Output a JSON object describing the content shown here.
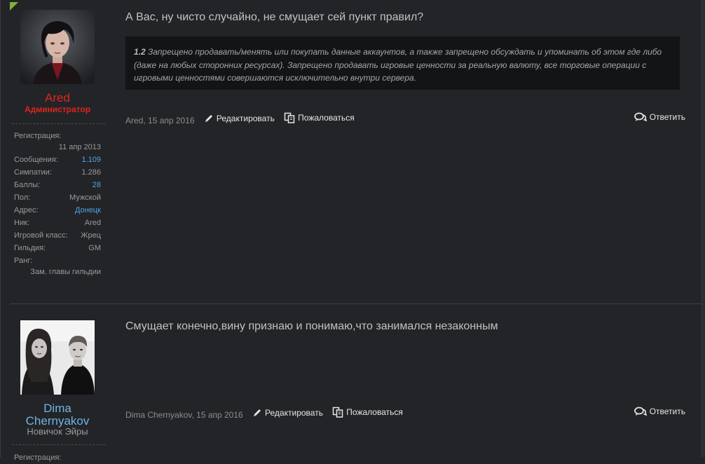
{
  "posts": [
    {
      "author": "Ared",
      "user_title": "Администратор",
      "extra": [
        {
          "key": "Регистрация:",
          "value": "11 апр 2013"
        },
        {
          "key": "Сообщения:",
          "value": "1.109"
        },
        {
          "key": "Симпатии:",
          "value": "1.286"
        },
        {
          "key": "Баллы:",
          "value": "28"
        },
        {
          "key": "Пол:",
          "value": "Мужской"
        },
        {
          "key": "Адрес:",
          "value": "Донецк"
        },
        {
          "key": "Ник:",
          "value": "Ared"
        },
        {
          "key": "Игровой класс:",
          "value": "Жрец"
        },
        {
          "key": "Гильдия:",
          "value": "GM"
        },
        {
          "key": "Ранг:",
          "value": "Зам. главы гильдии"
        }
      ],
      "text": "А Вас, ну чисто случайно, не смущает сей пункт правил?",
      "quote": {
        "number": "1.2",
        "body": "Запрещено продавать/менять или покупать данные аккаунтов, а также запрещено обсуждать и упоминать об этом где либо (даже на любых сторонних ресурсах). Запрещено продавать игровые ценности за реальную валюту, все торговые операции с игровыми ценностями совершаются исключительно внутри сервера."
      },
      "meta": "Ared, 15 апр 2016",
      "edit_label": "Редактировать",
      "report_label": "Пожаловаться",
      "reply_label": "Ответить"
    },
    {
      "author_line1": "Dima",
      "author_line2": "Chernyakov",
      "user_title": "Новичок Эйры",
      "extra": [
        {
          "key": "Регистрация:",
          "value": ""
        }
      ],
      "text": "Смущает конечно,вину признаю и понимаю,что занимался незаконным",
      "meta": "Dima Chernyakov, 15 апр 2016",
      "edit_label": "Редактировать",
      "report_label": "Пожаловаться",
      "reply_label": "Ответить"
    }
  ],
  "colors": {
    "background": "#232427",
    "admin_red": "#e0241c",
    "link_blue": "#4ea6e3",
    "quote_bg": "#131416"
  }
}
